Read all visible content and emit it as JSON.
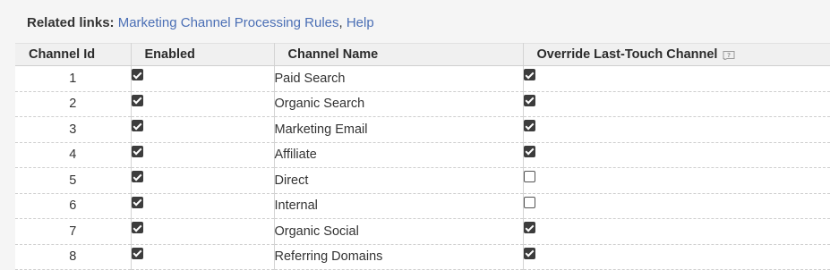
{
  "related_links": {
    "label": "Related links:",
    "links": [
      "Marketing Channel Processing Rules",
      "Help"
    ],
    "separator": ","
  },
  "table": {
    "columns": [
      "Channel Id",
      "Enabled",
      "Channel Name",
      "Override Last-Touch Channel"
    ],
    "rows": [
      {
        "id": "1",
        "enabled": true,
        "name": "Paid Search",
        "override": true
      },
      {
        "id": "2",
        "enabled": true,
        "name": "Organic Search",
        "override": true
      },
      {
        "id": "3",
        "enabled": true,
        "name": "Marketing Email",
        "override": true
      },
      {
        "id": "4",
        "enabled": true,
        "name": "Affiliate",
        "override": true
      },
      {
        "id": "5",
        "enabled": true,
        "name": "Direct",
        "override": false
      },
      {
        "id": "6",
        "enabled": true,
        "name": "Internal",
        "override": false
      },
      {
        "id": "7",
        "enabled": true,
        "name": "Organic Social",
        "override": true
      },
      {
        "id": "8",
        "enabled": true,
        "name": "Referring Domains",
        "override": true
      }
    ]
  },
  "icons": {
    "override_help": "help-bubble-icon",
    "checkbox": "checkbox-icon"
  },
  "colors": {
    "link": "#4b6fb5",
    "checkbox_checked": "#3c3c3c",
    "header_bg": "#f0f0f0",
    "page_bg": "#f5f5f5"
  }
}
